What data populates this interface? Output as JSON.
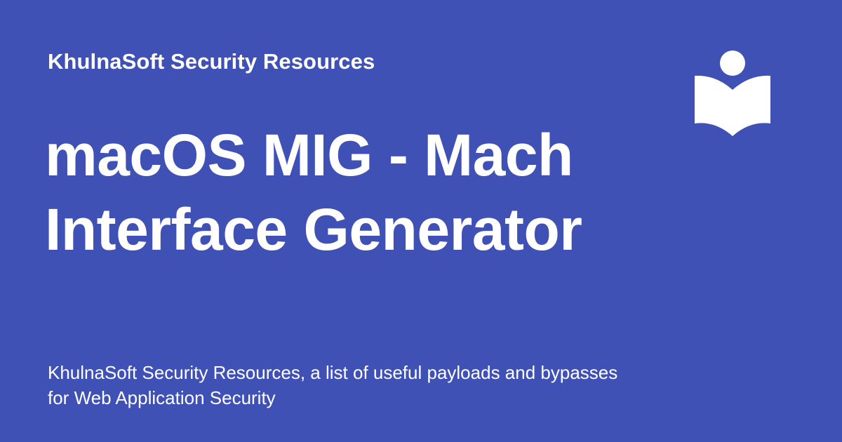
{
  "header": {
    "site_name": "KhulnaSoft Security Resources",
    "logo_icon": "open-book-reader-icon"
  },
  "main": {
    "title": "macOS MIG - Mach Interface Generator",
    "description": "KhulnaSoft Security Resources, a list of useful payloads and bypasses for Web Application Security"
  },
  "colors": {
    "background": "#3f51b5",
    "foreground": "#ffffff"
  }
}
